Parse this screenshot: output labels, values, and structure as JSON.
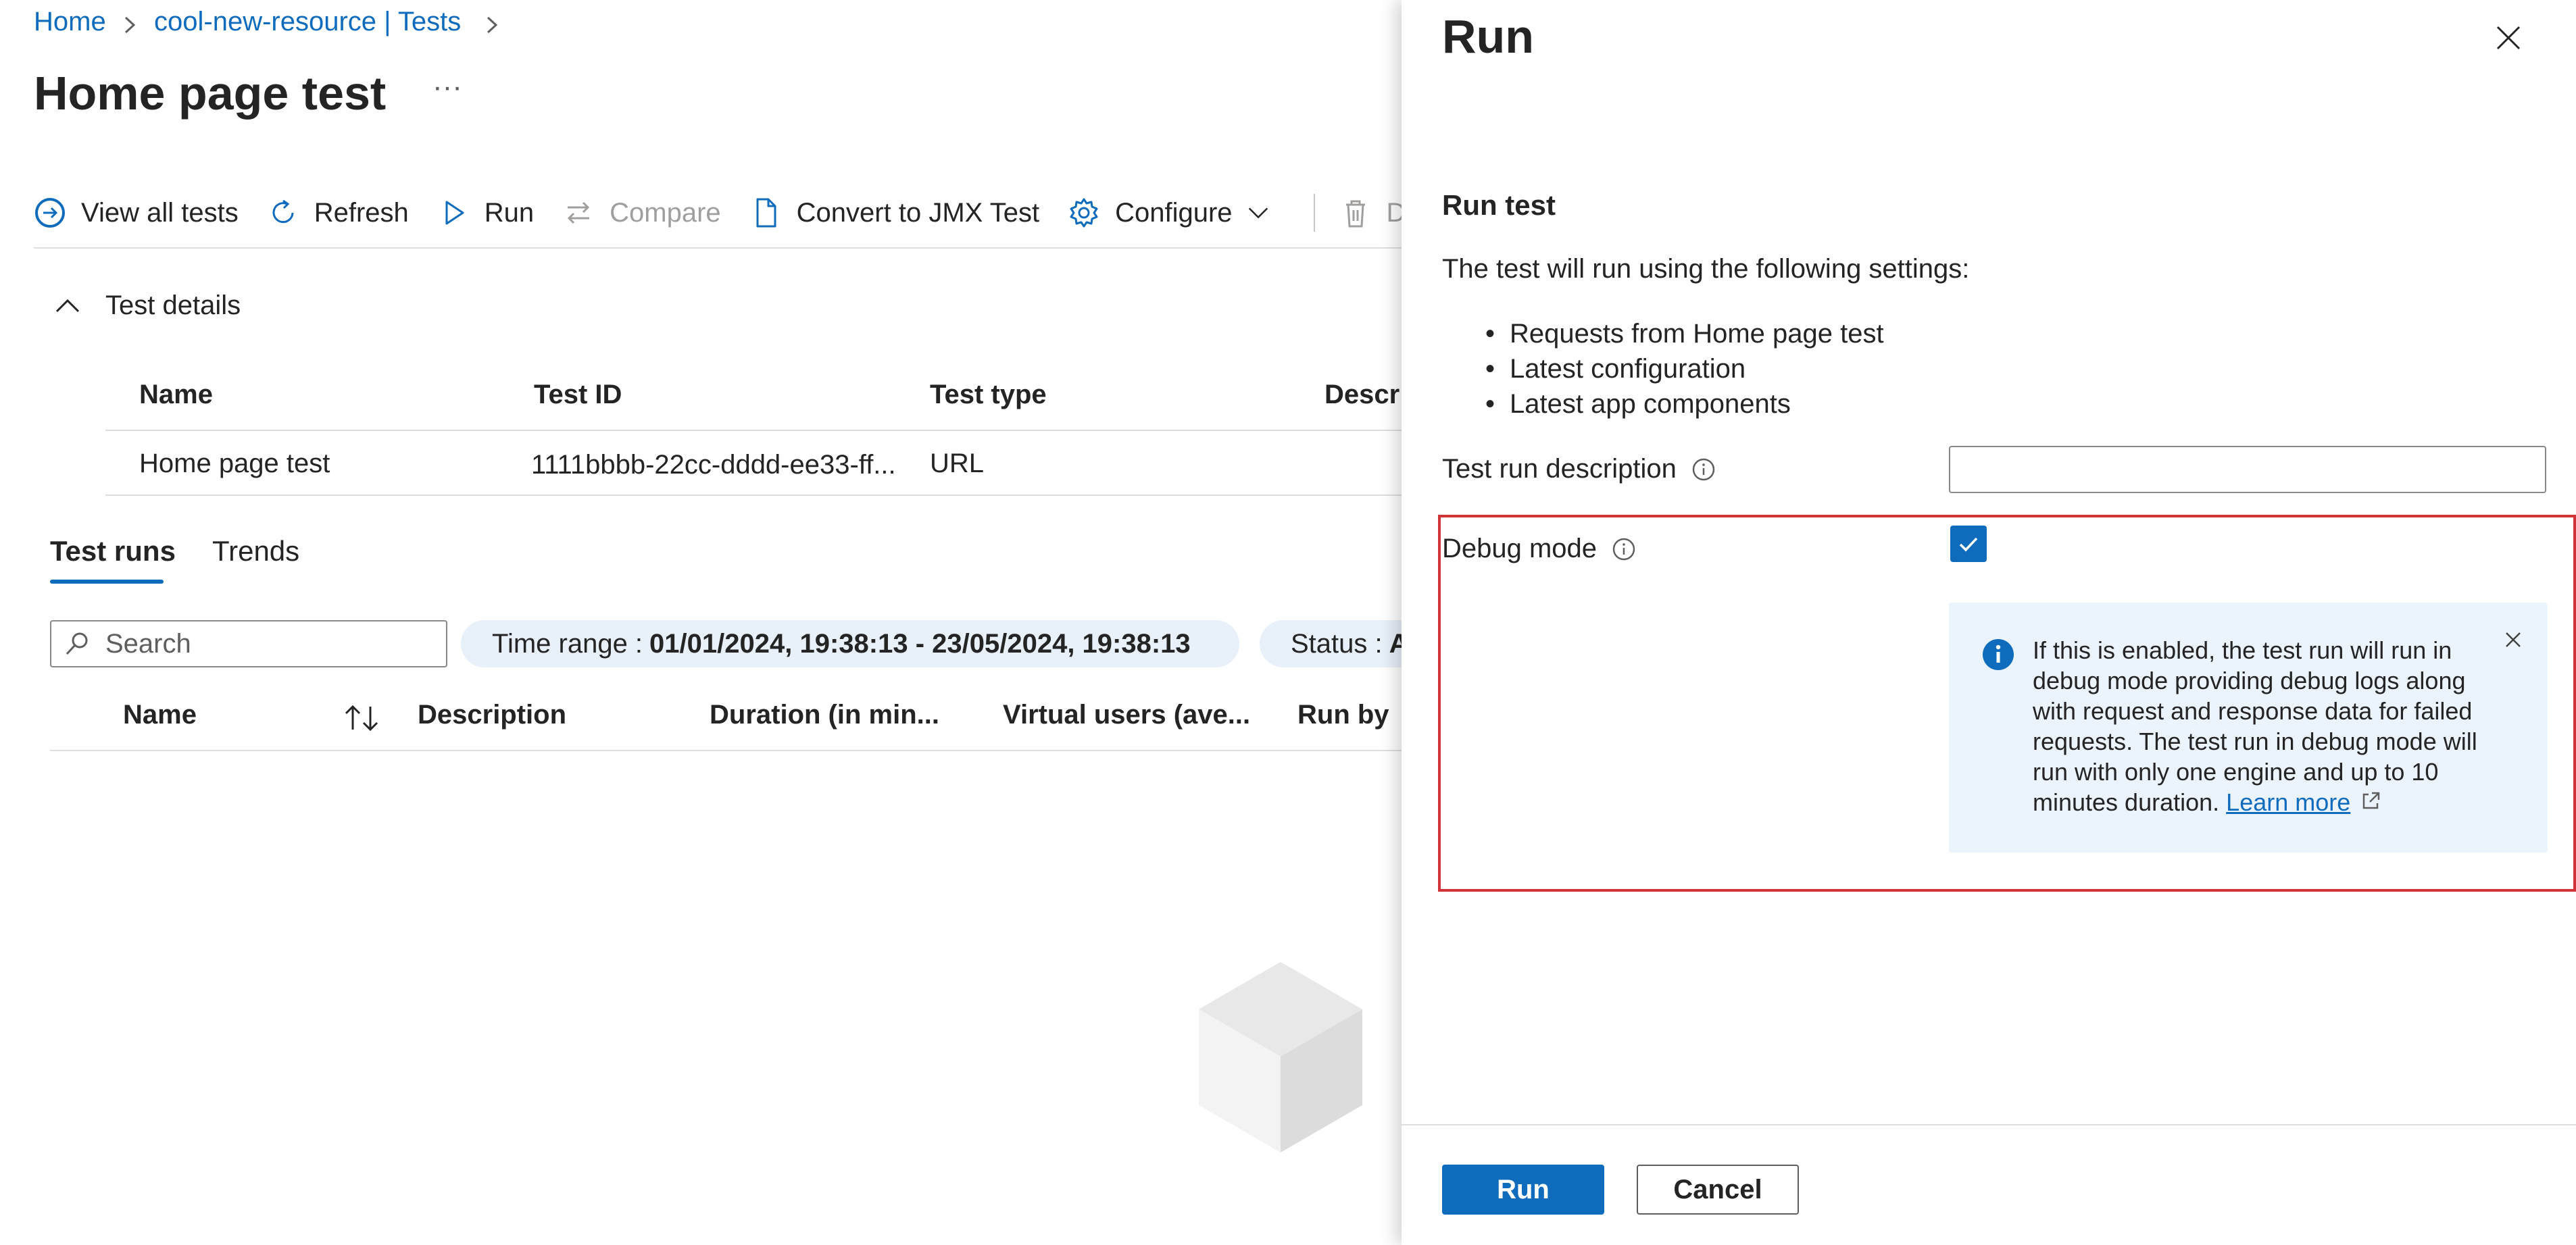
{
  "breadcrumb": {
    "home": "Home",
    "resource": "cool-new-resource | Tests"
  },
  "page": {
    "title": "Home page test",
    "more": "···"
  },
  "toolbar": {
    "view_all_tests": "View all tests",
    "refresh": "Refresh",
    "run": "Run",
    "compare": "Compare",
    "convert": "Convert to JMX Test",
    "configure": "Configure",
    "delete_partial": "D"
  },
  "test_details": {
    "title": "Test details",
    "headers": [
      "Name",
      "Test ID",
      "Test type",
      "Descri"
    ],
    "row": [
      "Home page test",
      "1111bbbb-22cc-dddd-ee33-ff...",
      "URL"
    ]
  },
  "tabs": [
    "Test runs",
    "Trends"
  ],
  "runs": {
    "search_placeholder": "Search",
    "time_range_label": "Time range : ",
    "time_range_value": "01/01/2024, 19:38:13 - 23/05/2024, 19:38:13",
    "status_label": "Status : ",
    "status_value": "A",
    "headers": [
      "Name",
      "Description",
      "Duration (in min...",
      "Virtual users (ave...",
      "Run by"
    ]
  },
  "panel": {
    "title": "Run",
    "heading": "Run test",
    "intro": "The test will run using the following settings:",
    "settings": [
      "Requests from Home page test",
      "Latest configuration",
      "Latest app components"
    ],
    "description_label": "Test run description",
    "description_value": "",
    "debug_label": "Debug mode",
    "debug_checked": true,
    "info_text": "If this is enabled, the test run will run in debug mode providing debug logs along with request and response data for failed requests. The test run in debug mode will run with only one engine and up to 10 minutes duration.",
    "learn_more": "Learn more",
    "run_button": "Run",
    "cancel_button": "Cancel"
  },
  "colors": {
    "accent": "#0f6cbd",
    "highlight": "#d13438",
    "info_bg": "#ebf3fc"
  }
}
